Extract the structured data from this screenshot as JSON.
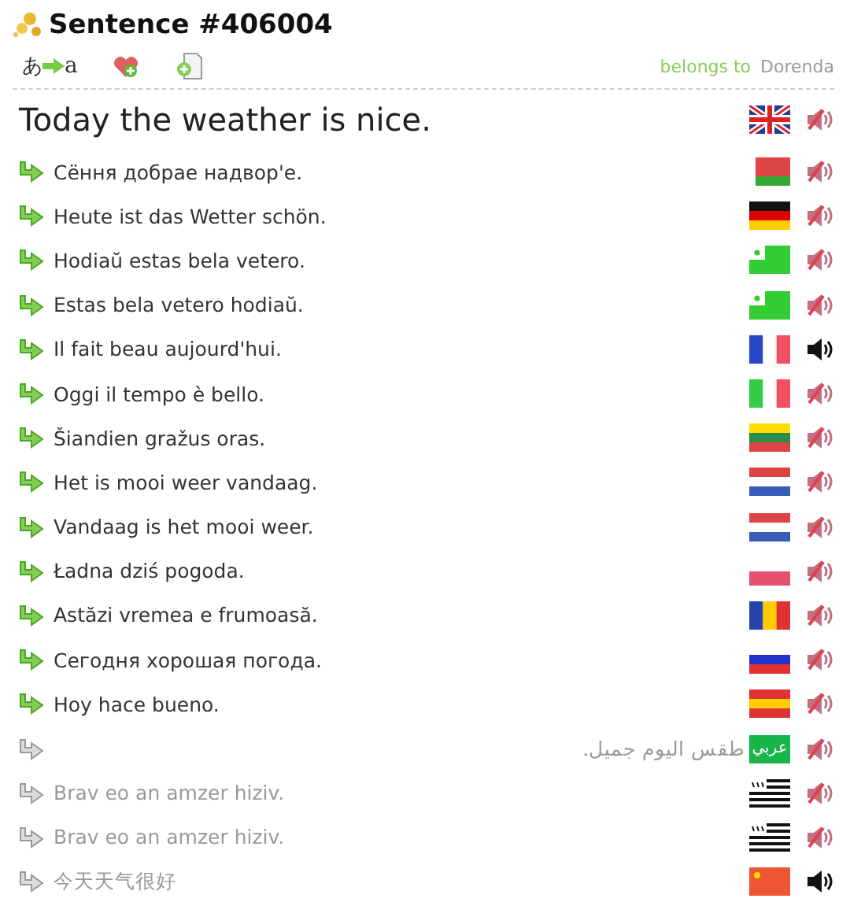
{
  "title": "Sentence #406004",
  "toolbar": {
    "translate_from": "あ",
    "translate_to": "a",
    "owner_label": "belongs to",
    "owner": "Dorenda"
  },
  "main": {
    "text": "Today the weather is nice.",
    "kind": "uk",
    "audio": false
  },
  "translations": [
    {
      "text": "Сёння добрае надвор'е.",
      "kind": "by",
      "audio": false,
      "direct": true
    },
    {
      "text": "Heute ist das Wetter schön.",
      "kind": "de",
      "audio": false,
      "direct": true
    },
    {
      "text": "Hodiaŭ estas bela vetero.",
      "kind": "eo",
      "audio": false,
      "direct": true
    },
    {
      "text": "Estas bela vetero hodiaŭ.",
      "kind": "eo",
      "audio": false,
      "direct": true
    },
    {
      "text": "Il fait beau aujourd'hui.",
      "kind": "fr",
      "audio": true,
      "direct": true
    },
    {
      "text": "Oggi il tempo è bello.",
      "kind": "it",
      "audio": false,
      "direct": true
    },
    {
      "text": "Šiandien gražus oras.",
      "kind": "lt",
      "audio": false,
      "direct": true
    },
    {
      "text": "Het is mooi weer vandaag.",
      "kind": "nl",
      "audio": false,
      "direct": true
    },
    {
      "text": "Vandaag is het mooi weer.",
      "kind": "nl",
      "audio": false,
      "direct": true
    },
    {
      "text": "Ładna dziś pogoda.",
      "kind": "pl",
      "audio": false,
      "direct": true
    },
    {
      "text": "Astăzi vremea e frumoasă.",
      "kind": "ro",
      "audio": false,
      "direct": true
    },
    {
      "text": "Сегодня хорошая погода.",
      "kind": "ru",
      "audio": false,
      "direct": true
    },
    {
      "text": "Hoy hace bueno.",
      "kind": "es",
      "audio": false,
      "direct": true
    },
    {
      "text": "طقس اليوم جميل.",
      "kind": "ar",
      "flag_text": "عربي",
      "rtl": true,
      "audio": false,
      "direct": false
    },
    {
      "text": "Brav eo an amzer hiziv.",
      "kind": "br",
      "audio": false,
      "direct": false
    },
    {
      "text": "Brav eo an amzer hiziv.",
      "kind": "br",
      "audio": false,
      "direct": false
    },
    {
      "text": "今天天气很好",
      "kind": "cn",
      "audio": true,
      "direct": false
    }
  ]
}
